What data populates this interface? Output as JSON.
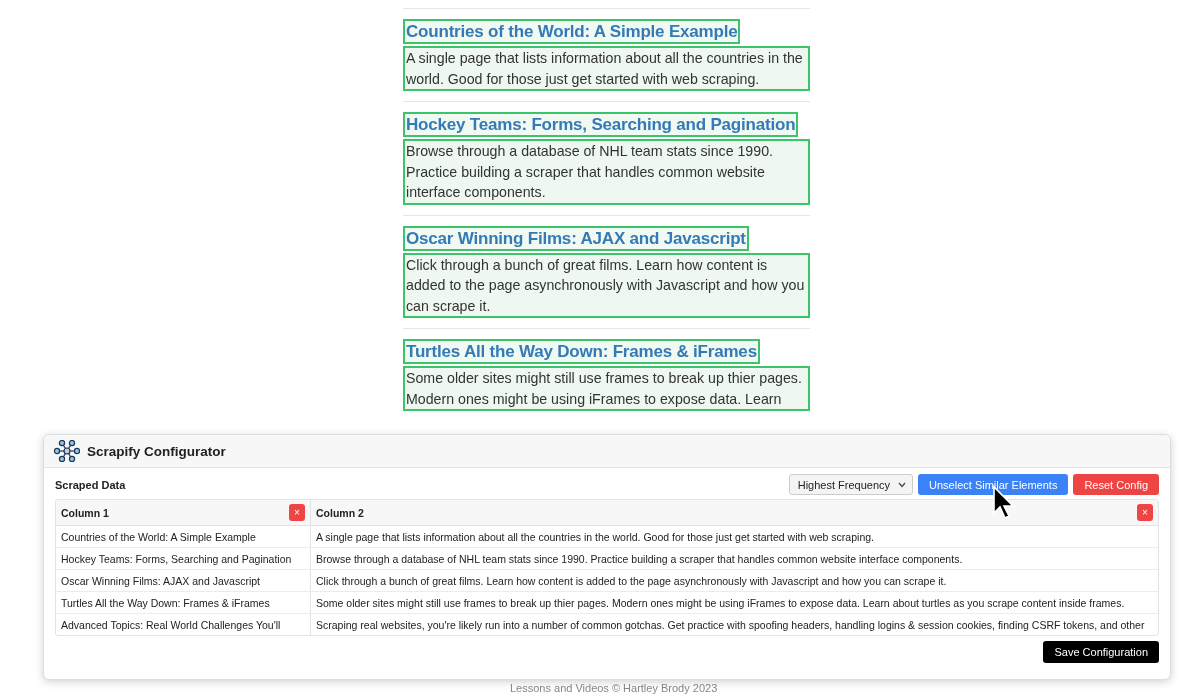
{
  "page": {
    "items": [
      {
        "title": "Countries of the World: A Simple Example",
        "description": "A single page that lists information about all the countries in the world. Good for those just get started with web scraping."
      },
      {
        "title": "Hockey Teams: Forms, Searching and Pagination",
        "description": "Browse through a database of NHL team stats since 1990. Practice building a scraper that handles common website interface components."
      },
      {
        "title": "Oscar Winning Films: AJAX and Javascript",
        "description": "Click through a bunch of great films. Learn how content is added to the page asynchronously with Javascript and how you can scrape it."
      },
      {
        "title": "Turtles All the Way Down: Frames & iFrames",
        "description": "Some older sites might still use frames to break up thier pages. Modern ones might be using iFrames to expose data. Learn"
      }
    ],
    "footer": "Lessons and Videos © Hartley Brody 2023"
  },
  "panel": {
    "title": "Scrapify Configurator",
    "section_label": "Scraped Data",
    "sort_select": {
      "value": "Highest Frequency"
    },
    "buttons": [
      {
        "label": "Unselect Similar Elements",
        "kind": "primary"
      },
      {
        "label": "Reset Config",
        "kind": "danger"
      }
    ],
    "table": {
      "columns": [
        {
          "label": "Column 1",
          "remove": "×"
        },
        {
          "label": "Column 2",
          "remove": "×"
        }
      ],
      "rows": [
        [
          "Countries of the World: A Simple Example",
          "A single page that lists information about all the countries in the world. Good for those just get started with web scraping."
        ],
        [
          "Hockey Teams: Forms, Searching and Pagination",
          "Browse through a database of NHL team stats since 1990. Practice building a scraper that handles common website interface components."
        ],
        [
          "Oscar Winning Films: AJAX and Javascript",
          "Click through a bunch of great films. Learn how content is added to the page asynchronously with Javascript and how you can scrape it."
        ],
        [
          "Turtles All the Way Down: Frames & iFrames",
          "Some older sites might still use frames to break up thier pages. Modern ones might be using iFrames to expose data. Learn about turtles as you scrape content inside frames."
        ],
        [
          "Advanced Topics: Real World Challenges You'll",
          "Scraping real websites, you're likely run into a number of common gotchas. Get practice with spoofing headers, handling logins & session cookies, finding CSRF tokens, and other"
        ]
      ]
    },
    "save_button": "Save Configuration"
  }
}
